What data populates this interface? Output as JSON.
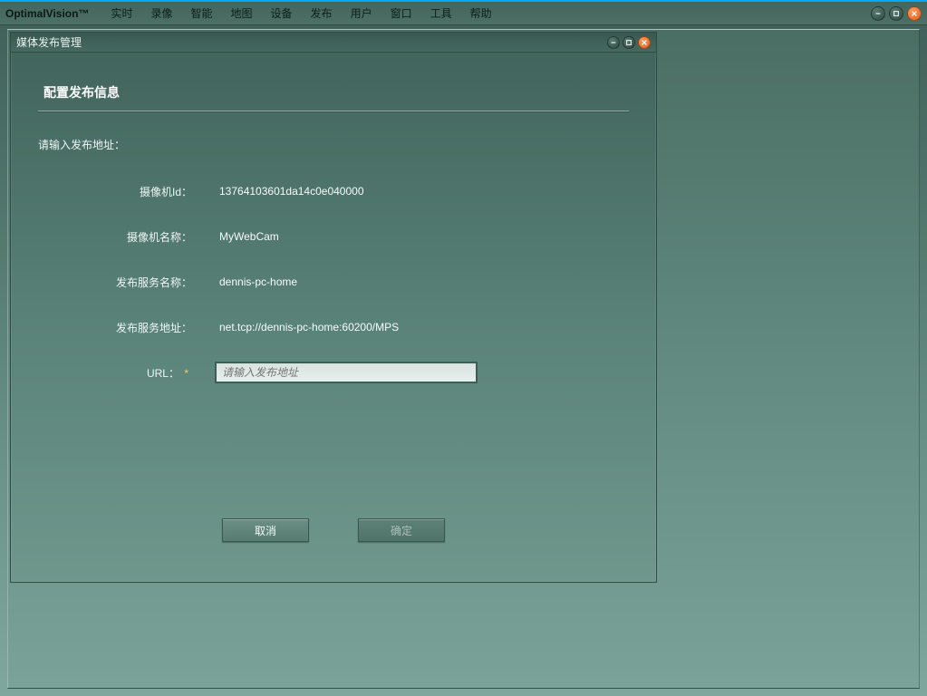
{
  "app": {
    "title": "OptimalVision™"
  },
  "menu": {
    "items": [
      "实时",
      "录像",
      "智能",
      "地图",
      "设备",
      "发布",
      "用户",
      "窗口",
      "工具",
      "帮助"
    ]
  },
  "subwindow": {
    "title": "媒体发布管理",
    "heading": "配置发布信息",
    "prompt": "请输入发布地址：",
    "fields": {
      "camera_id": {
        "label": "摄像机Id：",
        "value": "13764103601da14c0e040000"
      },
      "camera_name": {
        "label": "摄像机名称：",
        "value": "MyWebCam"
      },
      "service_name": {
        "label": "发布服务名称：",
        "value": "dennis-pc-home"
      },
      "service_addr": {
        "label": "发布服务地址：",
        "value": "net.tcp://dennis-pc-home:60200/MPS"
      },
      "url": {
        "label": "URL：",
        "placeholder": "请输入发布地址",
        "required_mark": "*"
      }
    },
    "buttons": {
      "cancel": "取消",
      "ok": "确定"
    }
  }
}
